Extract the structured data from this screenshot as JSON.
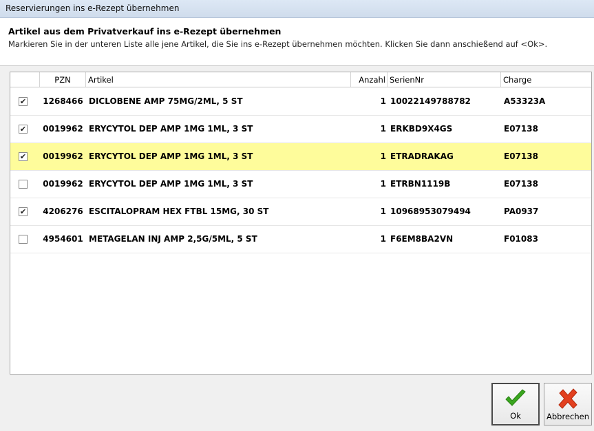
{
  "window": {
    "title": "Reservierungen ins e-Rezept übernehmen"
  },
  "header": {
    "title": "Artikel aus dem Privatverkauf ins e-Rezept übernehmen",
    "description": "Markieren Sie in der unteren Liste alle jene Artikel, die Sie ins e-Rezept übernehmen möchten. Klicken Sie dann anschießend auf <Ok>."
  },
  "table": {
    "columns": {
      "check": "",
      "pzn": "PZN",
      "artikel": "Artikel",
      "anzahl": "Anzahl",
      "seriennr": "SerienNr",
      "charge": "Charge"
    },
    "rows": [
      {
        "checked": true,
        "pzn": "1268466",
        "artikel": "DICLOBENE AMP 75MG/2ML, 5 ST",
        "anzahl": "1",
        "seriennr": "10022149788782",
        "charge": "A53323A",
        "selected": false
      },
      {
        "checked": true,
        "pzn": "0019962",
        "artikel": "ERYCYTOL DEP AMP 1MG 1ML, 3 ST",
        "anzahl": "1",
        "seriennr": "ERKBD9X4GS",
        "charge": "E07138",
        "selected": false
      },
      {
        "checked": true,
        "pzn": "0019962",
        "artikel": "ERYCYTOL DEP AMP 1MG 1ML, 3 ST",
        "anzahl": "1",
        "seriennr": "ETRADRAKAG",
        "charge": "E07138",
        "selected": true
      },
      {
        "checked": false,
        "pzn": "0019962",
        "artikel": "ERYCYTOL DEP AMP 1MG 1ML, 3 ST",
        "anzahl": "1",
        "seriennr": "ETRBN1119B",
        "charge": "E07138",
        "selected": false
      },
      {
        "checked": true,
        "pzn": "4206276",
        "artikel": "ESCITALOPRAM HEX FTBL 15MG, 30 ST",
        "anzahl": "1",
        "seriennr": "10968953079494",
        "charge": "PA0937",
        "selected": false
      },
      {
        "checked": false,
        "pzn": "4954601",
        "artikel": "METAGELAN INJ AMP 2,5G/5ML, 5 ST",
        "anzahl": "1",
        "seriennr": "F6EM8BA2VN",
        "charge": "F01083",
        "selected": false
      }
    ],
    "checkmark_glyph": "✔",
    "selected_row_color": "#fefc9b"
  },
  "buttons": {
    "ok": {
      "label": "Ok",
      "icon": "green-checkmark-icon",
      "color": "#3aa61f"
    },
    "cancel": {
      "label": "Abbrechen",
      "icon": "red-x-icon",
      "color": "#e2401f"
    }
  }
}
